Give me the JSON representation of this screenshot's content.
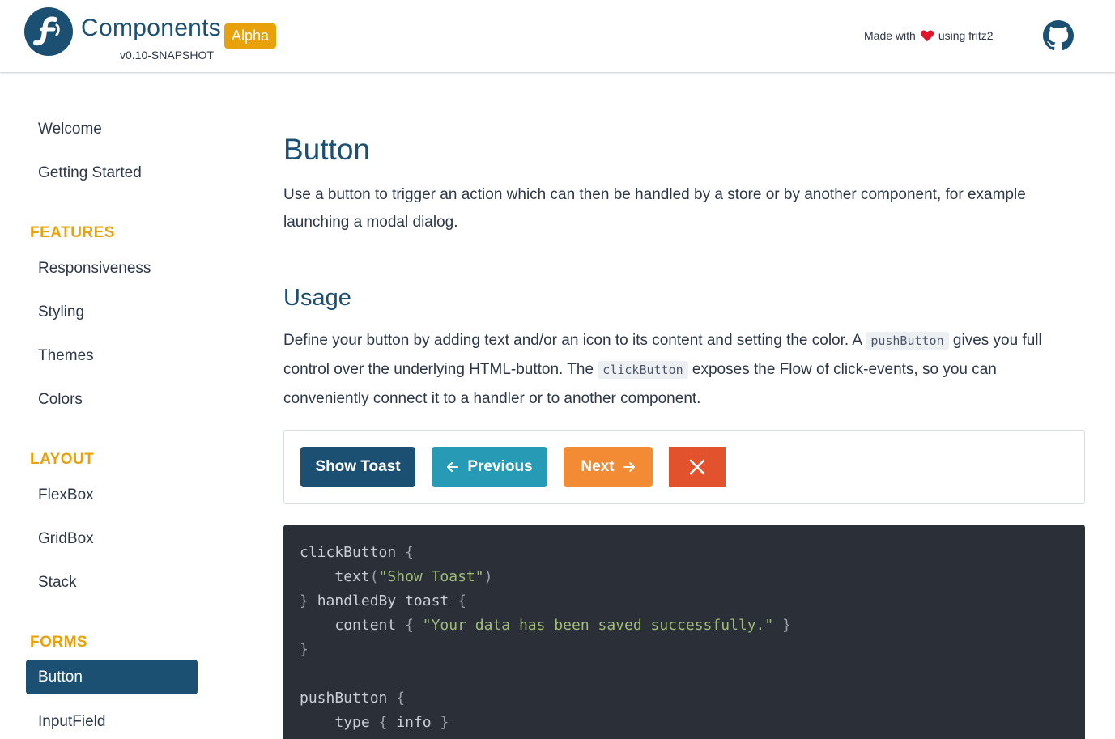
{
  "header": {
    "brand": "Components",
    "version": "v0.10-SNAPSHOT",
    "badge": "Alpha",
    "made_prefix": "Made with",
    "made_suffix": "using fritz2",
    "accent": "#1b5073",
    "badge_color": "#e8a10b"
  },
  "sidebar": {
    "items_top": [
      {
        "label": "Welcome"
      },
      {
        "label": "Getting Started"
      }
    ],
    "sections": [
      {
        "title": "FEATURES",
        "items": [
          "Responsiveness",
          "Styling",
          "Themes",
          "Colors"
        ]
      },
      {
        "title": "LAYOUT",
        "items": [
          "FlexBox",
          "GridBox",
          "Stack"
        ]
      },
      {
        "title": "FORMS",
        "items": [
          "Button",
          "InputField"
        ]
      }
    ],
    "active": "Button"
  },
  "main": {
    "title": "Button",
    "intro": "Use a button to trigger an action which can then be handled by a store or by another component, for example launching a modal dialog.",
    "usage_title": "Usage",
    "usage_p1": "Define your button by adding text and/or an icon to its content and setting the color. A",
    "usage_code1": "pushButton",
    "usage_p2": "gives you full control over the underlying HTML-button. The",
    "usage_code2": "clickButton",
    "usage_p3": "exposes the Flow of click-events, so you can conveniently connect it to a handler or to another component."
  },
  "demo": {
    "show_toast": "Show Toast",
    "previous": "Previous",
    "next": "Next",
    "colors": {
      "primary": "#1b5073",
      "info": "#279bb6",
      "warning": "#f38b34",
      "danger": "#e2532d"
    }
  },
  "code": {
    "l1_kw": "clickButton",
    "l2_fn": "text",
    "l2_str": "\"Show Toast\"",
    "l3_a": "handledBy",
    "l3_b": "toast",
    "l4_fn": "content",
    "l4_str": "\"Your data has been saved successfully.\"",
    "l7_kw": "pushButton",
    "l8_fn": "type",
    "l8_val": "info"
  }
}
